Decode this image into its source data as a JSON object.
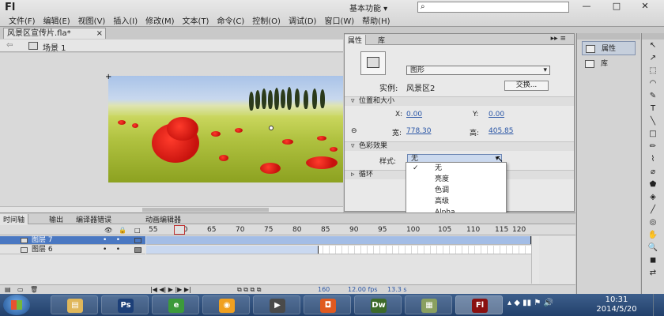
{
  "app": {
    "logo": "Fl"
  },
  "menu": [
    "文件(F)",
    "编辑(E)",
    "视图(V)",
    "插入(I)",
    "修改(M)",
    "文本(T)",
    "命令(C)",
    "控制(O)",
    "调试(D)",
    "窗口(W)",
    "帮助(H)"
  ],
  "workspace": {
    "label": "基本功能 ▾"
  },
  "search": {
    "placeholder": "",
    "icon": "search-icon"
  },
  "window_controls": {
    "minimize": "—",
    "maximize": "□",
    "close": "✕"
  },
  "document": {
    "tab": "风景区宣传片.fla*",
    "close": "×",
    "scene": "场景 1",
    "back": "⇦"
  },
  "properties": {
    "tab_properties": "属性",
    "tab_library": "库",
    "menu_glyph": "▸▸ ≡",
    "symbol_type": "图形",
    "instance_label": "实例:",
    "instance_name": "风景区2",
    "swap_button": "交换...",
    "section_position": "位置和大小",
    "x_label": "X:",
    "x_value": "0.00",
    "y_label": "Y:",
    "y_value": "0.00",
    "width_label": "宽:",
    "width_value": "778.30",
    "height_label": "高:",
    "height_value": "405.85",
    "section_color": "色彩效果",
    "style_label": "样式:",
    "style_value": "无",
    "section_loop": "循环"
  },
  "style_dropdown": {
    "options": [
      "无",
      "亮度",
      "色调",
      "高级",
      "Alpha"
    ],
    "selected": "无"
  },
  "right_panel": {
    "properties": "属性",
    "library": "库"
  },
  "tools": [
    "↖",
    "↗",
    "⬚",
    "◠",
    "✎",
    "T",
    "╲",
    "□",
    "✏",
    "⌇",
    "⌀",
    "⬟",
    "◈",
    "╱",
    "◎",
    "✋",
    "🔍",
    "◼",
    "⇄"
  ],
  "timeline": {
    "tabs": [
      "时间轴",
      "输出",
      "编译器错误",
      "动画编辑器"
    ],
    "ruler": [
      "55",
      "60",
      "65",
      "70",
      "75",
      "80",
      "85",
      "90",
      "95",
      "100",
      "105",
      "110",
      "115",
      "120"
    ],
    "layers": [
      {
        "name": "图层 7",
        "selected": true
      },
      {
        "name": "图层 6",
        "selected": false
      }
    ],
    "footer": {
      "frame": "160",
      "fps": "12.00 fps",
      "time": "13.3 s"
    }
  },
  "taskbar": {
    "apps": [
      {
        "name": "explorer",
        "glyph": "▤",
        "color": "#e0b75a"
      },
      {
        "name": "photoshop",
        "glyph": "Ps",
        "color": "#1c3f78"
      },
      {
        "name": "browser",
        "glyph": "e",
        "color": "#3c9a3a"
      },
      {
        "name": "media",
        "glyph": "◉",
        "color": "#f0a020"
      },
      {
        "name": "capture",
        "glyph": "▶",
        "color": "#4a4a4a"
      },
      {
        "name": "recorder",
        "glyph": "◘",
        "color": "#e05a20"
      },
      {
        "name": "dreamweaver",
        "glyph": "Dw",
        "color": "#3d6a2a"
      },
      {
        "name": "files",
        "glyph": "▦",
        "color": "#8aa060"
      },
      {
        "name": "flash",
        "glyph": "Fl",
        "color": "#8a1010"
      }
    ],
    "clock_time": "10:31",
    "clock_date": "2014/5/20"
  },
  "colors": {
    "accent": "#4a78c2",
    "link": "#2a56a6",
    "selected_layer": "#4a78c2"
  }
}
